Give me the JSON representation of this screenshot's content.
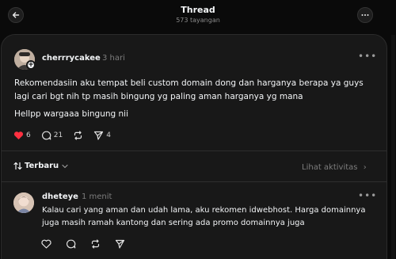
{
  "header": {
    "title": "Thread",
    "subtitle": "573 tayangan"
  },
  "post": {
    "username": "cherrrycakee",
    "time": "3 hari",
    "text": "Rekomendasiin aku tempat beli custom domain dong dan harganya berapa ya guys lagi cari bgt nih tp masih bingung yg paling aman harganya yg mana",
    "text2": "Hellpp wargaaa bingung nii",
    "likes": "6",
    "comments": "21",
    "shares": "4",
    "like_color": "#ff3040"
  },
  "sort": {
    "label": "Terbaru",
    "activity_label": "Lihat aktivitas"
  },
  "reply": {
    "username": "dheteye",
    "time": "1 menit",
    "text": "Kalau cari yang aman dan udah lama, aku rekomen idwebhost. Harga domainnya juga masih ramah kantong dan sering ada promo domainnya juga"
  },
  "icons": {
    "back": "arrow-left-icon",
    "more": "more-horizontal-icon",
    "like": "heart-icon",
    "comment": "comment-icon",
    "repost": "repost-icon",
    "share": "send-icon",
    "sort": "sort-arrows-icon"
  }
}
